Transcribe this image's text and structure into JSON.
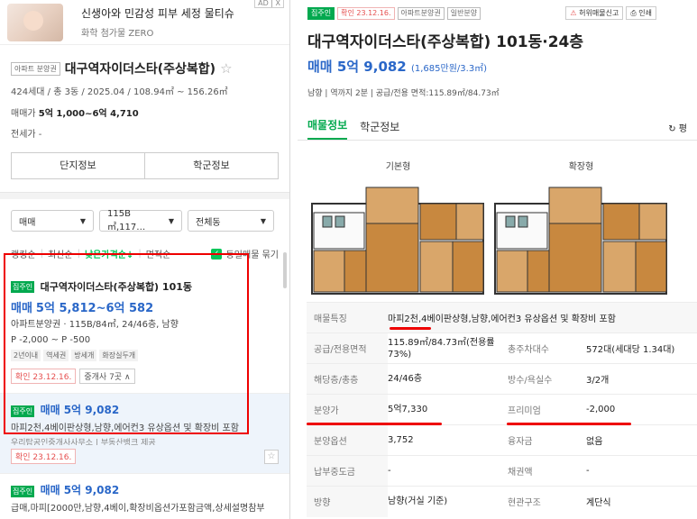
{
  "ad": {
    "title": "신생아와 민감성 피부 세정 물티슈",
    "sub": "화학 첨가물 ZERO",
    "badge": "AD | X"
  },
  "complex": {
    "tag": "아파트 분양권",
    "name": "대구역자이더스타(주상복합)",
    "meta": "424세대 / 총 3동 / 2025.04 / 108.94㎡ ~ 156.26㎡",
    "sale_label": "매매가",
    "sale_value": "5억 1,000~6억 4,710",
    "jeonse": "전세가 -"
  },
  "buttons": {
    "complex_info": "단지정보",
    "school_info": "학군정보"
  },
  "filters": {
    "trade": "매매",
    "area": "115B㎡,117…",
    "dong": "전체동"
  },
  "sort": {
    "ranking": "랭킹순",
    "latest": "최신순",
    "low_price": "낮은가격순↓",
    "area": "면적순",
    "group_label": "동일매물 묶기"
  },
  "listings": [
    {
      "badge": "집주인",
      "name": "대구역자이더스타(주상복합) 101동",
      "price_label": "매매",
      "price": "5억 5,812~6억 582",
      "line1": "아파트분양권 · 115B/84㎡, 24/46층, 남향",
      "line2": "P -2,000 ~ P -500",
      "chips": [
        "2년이내",
        "역세권",
        "방세개",
        "화장실두개"
      ],
      "confirm": "확인 23.12.16.",
      "agents": "중개사 7곳 ∧"
    },
    {
      "badge": "집주인",
      "price_label": "매매",
      "price": "5억 9,082",
      "line1": "마피2천,4베이판상형,남향,에어컨3 유상옵션 및 확장비 포함",
      "line2": "우리탑공인중개사사무소 | 부동산뱅크 제공",
      "confirm": "확인 23.12.16."
    },
    {
      "badge": "집주인",
      "price_label": "매매",
      "price": "5억 9,082",
      "line1": "급매,마피[2000만,남향,4베이,확장비옵션가포함금액,상세설명참부"
    }
  ],
  "detail": {
    "tags": [
      "집주인",
      "확인 23.12.16.",
      "아파트분양권",
      "일반분양"
    ],
    "report": "허위매물신고",
    "print": "인쇄",
    "title": "대구역자이더스타(주상복합) 101동·24층",
    "price_label": "매매",
    "price": "5억 9,082",
    "price_per": "(1,685만원/3.3㎡)",
    "sub": "남향 | 역까지 2분 | 공급/전용 면적:115.89㎡/84.73㎡",
    "tab1": "매물정보",
    "tab2": "학군정보",
    "refresh": "↻ 평",
    "plan1": "기본형",
    "plan2": "확장형",
    "rows": [
      {
        "k": "매물특징",
        "v": "마피2천,4베이판상형,남향,에어컨3 유상옵션 및 확장비 포함"
      },
      {
        "k": "공급/전용면적",
        "v": "115.89㎡/84.73㎡(전용률73%)",
        "k2": "총주차대수",
        "v2": "572대(세대당 1.34대)"
      },
      {
        "k": "해당층/총층",
        "v": "24/46층",
        "k2": "방수/욕실수",
        "v2": "3/2개"
      },
      {
        "k": "분양가",
        "v": "5억7,330",
        "k2": "프리미엄",
        "v2": "-2,000"
      },
      {
        "k": "분양옵션",
        "v": "3,752",
        "k2": "융자금",
        "v2": "없음"
      },
      {
        "k": "납부중도금",
        "v": "-",
        "k2": "채권액",
        "v2": "-"
      },
      {
        "k": "방향",
        "v": "남향(거실 기준)",
        "k2": "현관구조",
        "v2": "계단식"
      }
    ]
  },
  "colors": {
    "accent_green": "#03a94f",
    "price_blue": "#2a67c8",
    "highlight_red": "#e00000"
  }
}
